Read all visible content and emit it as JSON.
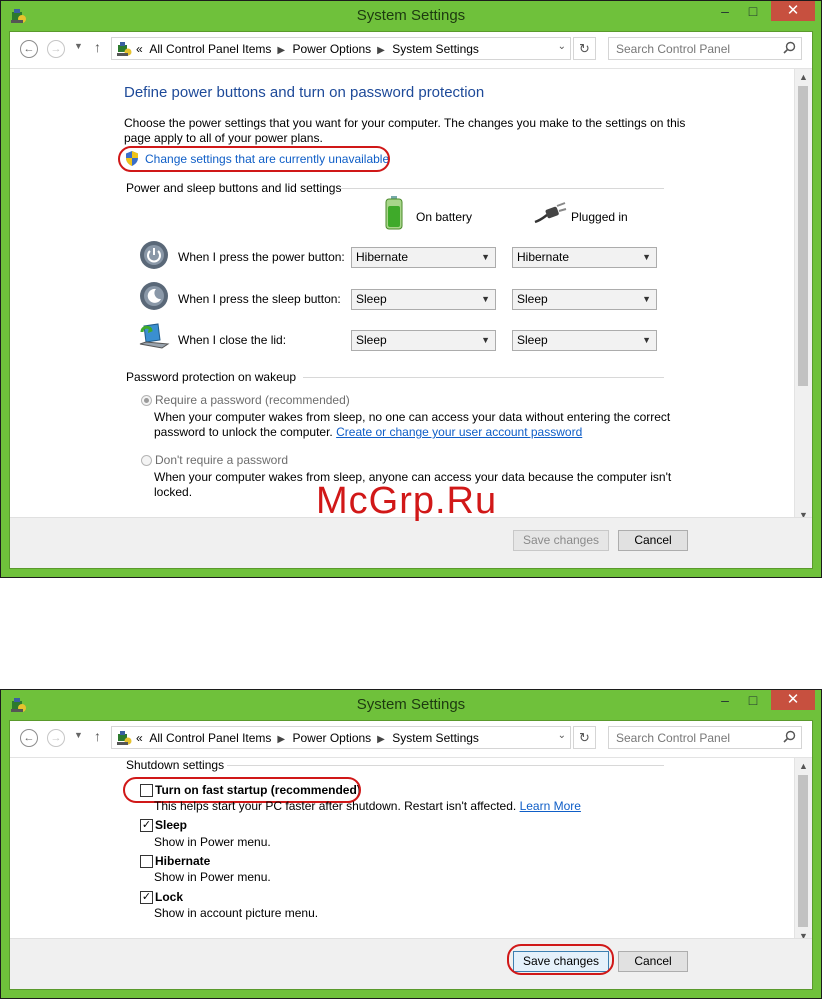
{
  "window": {
    "title": "System Settings",
    "minimize": "–",
    "maximize": "□",
    "close": "✕"
  },
  "address": {
    "overflow": "«",
    "crumbs": [
      "All Control Panel Items",
      "Power Options",
      "System Settings"
    ],
    "search_placeholder": "Search Control Panel"
  },
  "page": {
    "heading": "Define power buttons and turn on password protection",
    "intro_line1": "Choose the power settings that you want for your computer. The changes you make to the settings on this",
    "intro_line2": "page apply to all of your power plans.",
    "change_link": "Change settings that are currently unavailable",
    "power_group": "Power and sleep buttons and lid settings",
    "on_battery": "On battery",
    "plugged_in": "Plugged in",
    "rows": [
      {
        "label": "When I press the power button:",
        "battery": "Hibernate",
        "plugged": "Hibernate"
      },
      {
        "label": "When I press the sleep button:",
        "battery": "Sleep",
        "plugged": "Sleep"
      },
      {
        "label": "When I close the lid:",
        "battery": "Sleep",
        "plugged": "Sleep"
      }
    ],
    "password_group": "Password protection on wakeup",
    "require_label": "Require a password (recommended)",
    "require_desc1": "When your computer wakes from sleep, no one can access your data without entering the correct",
    "require_desc2": "password to unlock the computer.",
    "require_link": "Create or change your user account password",
    "norequire_label": "Don't require a password",
    "norequire_desc1": "When your computer wakes from sleep, anyone can access your data because the computer isn't",
    "norequire_desc2": "locked."
  },
  "page2": {
    "shutdown_group": "Shutdown settings",
    "items": [
      {
        "label": "Turn on fast startup (recommended)",
        "desc": "This helps start your PC faster after shutdown. Restart isn't affected.",
        "link": "Learn More",
        "checked": false
      },
      {
        "label": "Sleep",
        "desc": "Show in Power menu.",
        "checked": true
      },
      {
        "label": "Hibernate",
        "desc": "Show in Power menu.",
        "checked": false
      },
      {
        "label": "Lock",
        "desc": "Show in account picture menu.",
        "checked": true
      }
    ]
  },
  "buttons": {
    "save": "Save changes",
    "cancel": "Cancel"
  },
  "watermark": "McGrp.Ru",
  "colors": {
    "frame": "#6fc13b",
    "highlight_ring": "#d01818",
    "heading": "#1e4a99",
    "link": "#0f5ec7"
  }
}
